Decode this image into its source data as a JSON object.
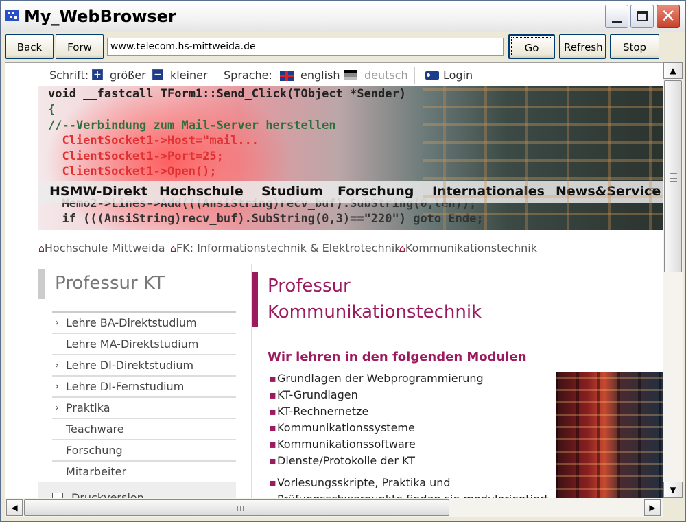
{
  "window": {
    "title": "My_WebBrowser",
    "min_glyph": "",
    "close_glyph": "✕"
  },
  "toolbar": {
    "back_label": "Back",
    "forward_label": "Forw",
    "url_value": "www.telecom.hs-mittweida.de",
    "go_label": "Go",
    "refresh_label": "Refresh",
    "stop_label": "Stop"
  },
  "page": {
    "topbar": {
      "font_label": "Schrift:",
      "bigger_label": "größer",
      "smaller_label": "kleiner",
      "language_label": "Sprache:",
      "english_label": "english",
      "german_label": "deutsch",
      "login_label": "Login",
      "plus_glyph": "+",
      "minus_glyph": "−"
    },
    "banner_code": [
      {
        "text": "void __fastcall TForm1::Send_Click(TObject *Sender)",
        "color": "#222222"
      },
      {
        "text": "{",
        "color": "#2e6f3e"
      },
      {
        "text": "//--Verbindung zum Mail-Server herstellen",
        "color": "#2e6f3e"
      },
      {
        "text": "  ClientSocket1->Host=\"mail...",
        "color": "#e03030"
      },
      {
        "text": "  ClientSocket1->Port=25;",
        "color": "#e03030"
      },
      {
        "text": "  ClientSocket1->Open();",
        "color": "#e03030"
      },
      {
        "text": "",
        "color": "#cc2020"
      },
      {
        "text": "  Memo2->Lines->Add(((AnsiString)recv_buf).SubString(0,len));",
        "color": "#333333"
      },
      {
        "text": "  if (((AnsiString)recv_buf).SubString(0,3)==\"220\") goto Ende;",
        "color": "#333333"
      }
    ],
    "nav": [
      "HSMW-Direkt",
      "Hochschule",
      "Studium",
      "Forschung",
      "Internationales",
      "News&Service"
    ],
    "menu_glyph": "≡",
    "breadcrumb": [
      "Hochschule Mittweida",
      "FK: Informationstechnik & Elektrotechnik",
      "Kommunikationstechnik"
    ],
    "home_glyph": "⌂",
    "sidebar": {
      "title": "Professur KT",
      "items": [
        {
          "label": "Lehre BA-Direktstudium",
          "chevron": "›"
        },
        {
          "label": "Lehre MA-Direktstudium",
          "chevron": ""
        },
        {
          "label": "Lehre DI-Direktstudium",
          "chevron": "›"
        },
        {
          "label": "Lehre DI-Fernstudium",
          "chevron": "›"
        },
        {
          "label": "Praktika",
          "chevron": "›"
        },
        {
          "label": "Teachware",
          "chevron": ""
        },
        {
          "label": "Forschung",
          "chevron": ""
        },
        {
          "label": "Mitarbeiter",
          "chevron": ""
        }
      ],
      "print_label": "Druckversion"
    },
    "content": {
      "heading_line1": "Professur",
      "heading_line2": "Kommunikationstechnik",
      "subheading": "Wir lehren in den folgenden Modulen",
      "bullet_glyph": "▪",
      "modules": [
        "Grundlagen der Webprogrammierung",
        "KT-Grundlagen",
        "KT-Rechnernetze",
        "Kommunikationssysteme",
        "Kommunikationssoftware",
        "Dienste/Protokolle der KT"
      ],
      "extra_line1": "Vorlesungsskripte, Praktika und",
      "extra_line2": "Prüfungsschwerpunkte finden sie modulorientiert"
    }
  },
  "scrollbars": {
    "up_glyph": "▲",
    "down_glyph": "▼",
    "left_glyph": "◀",
    "right_glyph": "▶"
  },
  "colors": {
    "accent": "#9c1a5e",
    "title_bar": "#f2f2f2",
    "close_button": "#c8412a"
  }
}
